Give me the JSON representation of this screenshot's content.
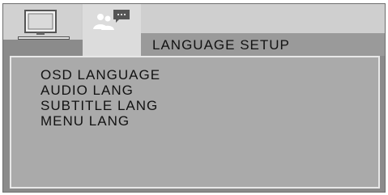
{
  "tabs": [
    {
      "icon": "tv-icon"
    },
    {
      "icon": "people-speech-icon"
    }
  ],
  "title": "LANGUAGE SETUP",
  "menu": {
    "items": [
      {
        "label": "OSD LANGUAGE"
      },
      {
        "label": "AUDIO LANG"
      },
      {
        "label": "SUBTITLE LANG"
      },
      {
        "label": "MENU LANG"
      }
    ]
  },
  "colors": {
    "frame": "#8b8b8b",
    "panel": "#aaaaaa",
    "tab_bar": "#cfcfcf",
    "active_tab": "#dcdcdc",
    "text": "#121212"
  }
}
